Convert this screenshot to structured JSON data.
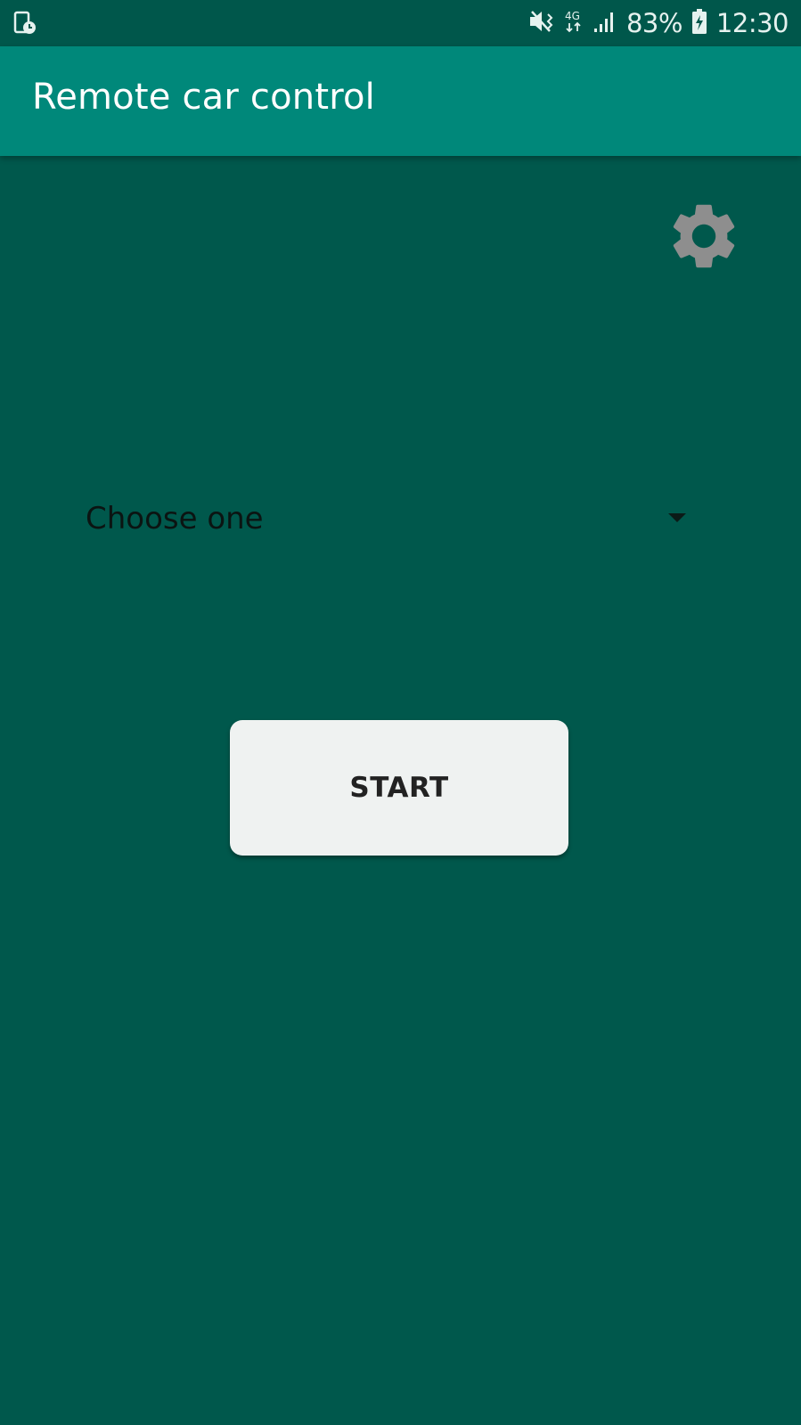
{
  "status_bar": {
    "left_icon": "screen-timer-icon",
    "mute_icon": "vibrate-mute-icon",
    "network_type": "4G",
    "signal_icon": "signal-bars-icon",
    "battery_percent": "83%",
    "battery_icon": "battery-charging-icon",
    "time": "12:30"
  },
  "app_bar": {
    "title": "Remote car control",
    "color": "#00887A"
  },
  "settings": {
    "icon": "gear-icon",
    "color": "#8E8E8E"
  },
  "spinner": {
    "selected": "Choose one",
    "icon": "dropdown-arrow-icon"
  },
  "start_button": {
    "label": "START"
  },
  "colors": {
    "background": "#00584C",
    "status_bar": "#00574B",
    "button": "#EFF2F1"
  }
}
